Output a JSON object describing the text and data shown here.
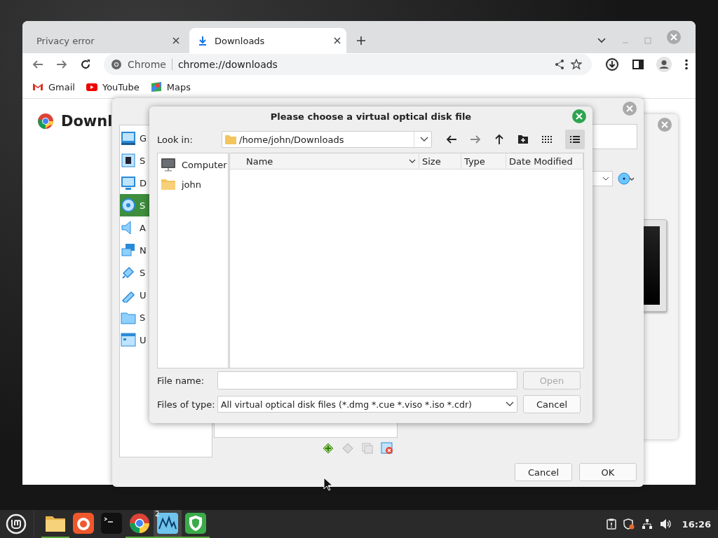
{
  "browser": {
    "tabs": [
      {
        "label": "Privacy error",
        "selected": false,
        "kind": "page"
      },
      {
        "label": "Downloads",
        "selected": true,
        "kind": "download"
      }
    ],
    "omnibox": {
      "site": "Chrome",
      "url": "chrome://downloads"
    },
    "bookmarks": [
      {
        "label": "Gmail",
        "kind": "mail"
      },
      {
        "label": "YouTube",
        "kind": "video"
      },
      {
        "label": "Maps",
        "kind": "map"
      }
    ],
    "page_heading": "Downl"
  },
  "settings_dialog": {
    "sidebar": [
      {
        "label": "G",
        "kind": "general",
        "selected": false
      },
      {
        "label": "S",
        "kind": "system",
        "selected": false
      },
      {
        "label": "D",
        "kind": "display",
        "selected": false
      },
      {
        "label": "S",
        "kind": "storage",
        "selected": true
      },
      {
        "label": "A",
        "kind": "audio",
        "selected": false
      },
      {
        "label": "N",
        "kind": "network",
        "selected": false
      },
      {
        "label": "S",
        "kind": "serial",
        "selected": false
      },
      {
        "label": "U",
        "kind": "usb",
        "selected": false
      },
      {
        "label": "S",
        "kind": "shared",
        "selected": false
      },
      {
        "label": "U",
        "kind": "ui",
        "selected": false
      }
    ],
    "buttons": [
      "Cancel",
      "OK"
    ]
  },
  "file_dialog": {
    "title": "Please choose a virtual optical disk file",
    "look_in_label": "Look in:",
    "look_in": "/home/john/Downloads",
    "places": [
      {
        "label": "Computer",
        "kind": "computer"
      },
      {
        "label": "john",
        "kind": "folder"
      }
    ],
    "columns": [
      "Name",
      "Size",
      "Type",
      "Date Modified"
    ],
    "file_name_label": "File name:",
    "file_type_label": "Files of type:",
    "file_type": "All virtual optical disk files (*.dmg *.cue *.viso *.iso *.cdr)",
    "open": {
      "label": "Open",
      "disabled": true
    },
    "cancel": "Cancel"
  },
  "taskbar": {
    "apps": [
      {
        "kind": "files",
        "running": true,
        "selected": false
      },
      {
        "kind": "firefox",
        "running": false,
        "selected": false
      },
      {
        "kind": "terminal",
        "running": false,
        "selected": false
      },
      {
        "kind": "chrome",
        "running": true,
        "selected": false
      },
      {
        "kind": "virtualbox",
        "running": true,
        "selected": true,
        "badge": "2"
      },
      {
        "kind": "shield",
        "running": true,
        "selected": false
      }
    ],
    "clock": "16:26"
  }
}
